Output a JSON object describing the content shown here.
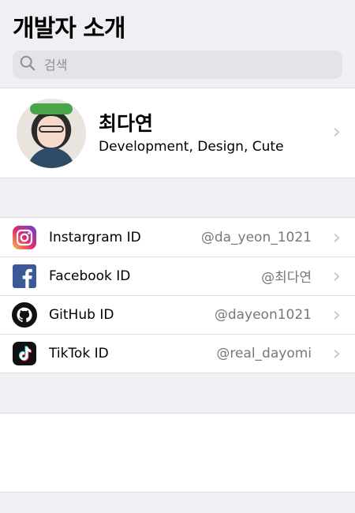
{
  "header": {
    "title": "개발자 소개"
  },
  "search": {
    "placeholder": "검색",
    "icon": "search-icon"
  },
  "profile": {
    "name": "최다연",
    "description": "Development, Design, Cute"
  },
  "accounts": [
    {
      "label": "Instargram ID",
      "value": "@da_yeon_1021",
      "icon": "instagram-icon"
    },
    {
      "label": "Facebook ID",
      "value": "@최다연",
      "icon": "facebook-icon"
    },
    {
      "label": "GitHub ID",
      "value": "@dayeon1021",
      "icon": "github-icon"
    },
    {
      "label": "TikTok ID",
      "value": "@real_dayomi",
      "icon": "tiktok-icon"
    }
  ],
  "colors": {
    "background": "#efeff4",
    "facebook": "#3b5998",
    "chevron": "#c7c7cc"
  }
}
